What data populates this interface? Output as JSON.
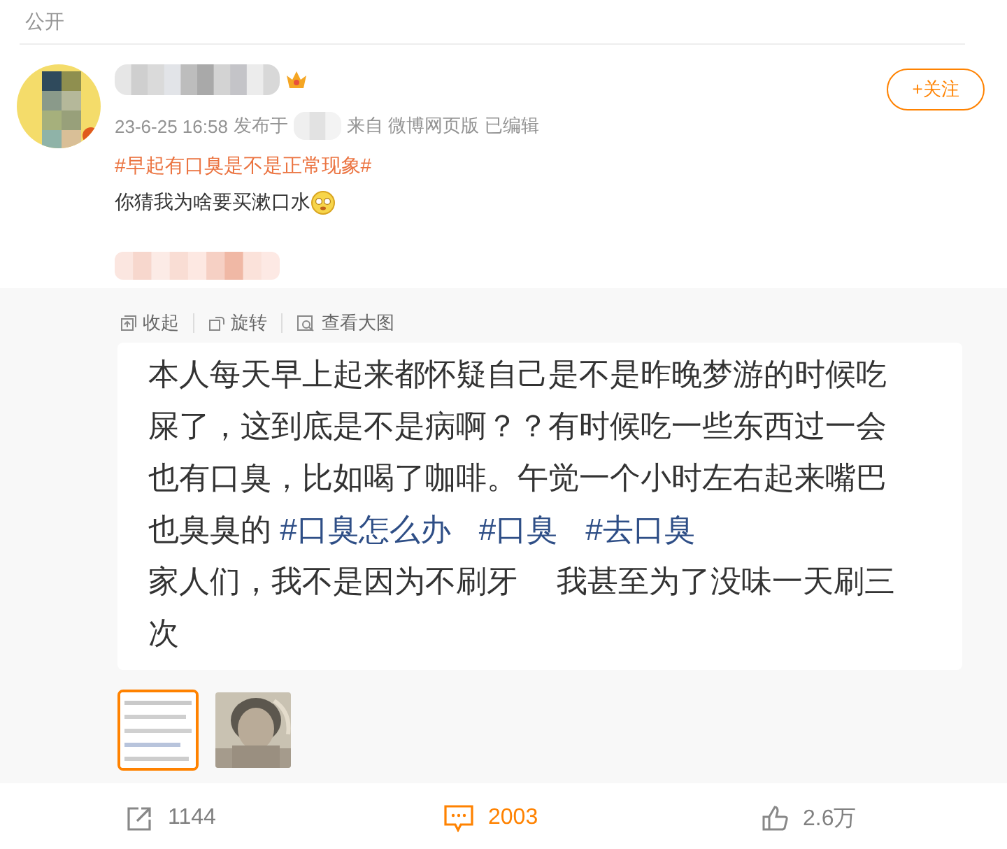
{
  "visibility": "公开",
  "post": {
    "timestamp": "23-6-25 16:58",
    "posted_at_label": "发布于",
    "source": "来自 微博网页版",
    "edited": "已编辑",
    "follow_button": "+关注",
    "topic": "#早起有口臭是不是正常现象#",
    "text": "你猜我为啥要买漱口水"
  },
  "media_toolbar": [
    {
      "kind": "collapse",
      "label": "收起"
    },
    {
      "kind": "rotate",
      "label": "旋转"
    },
    {
      "kind": "enlarge",
      "label": "查看大图"
    }
  ],
  "image_paragraphs": [
    {
      "segments": [
        {
          "kind": "text",
          "text": "本人每天早上起来都怀疑自己是不是昨晚梦游的时候吃屎了，这到底是不是病啊？？有时候吃一些东西过一会也有口臭，比如喝了咖啡。午觉一个小时左右起来嘴巴也臭臭的 "
        },
        {
          "kind": "hashtag",
          "text": "#口臭怎么办"
        },
        {
          "kind": "hashtag",
          "text": "#口臭"
        },
        {
          "kind": "hashtag",
          "text": "#去口臭"
        }
      ]
    },
    {
      "segments": [
        {
          "kind": "text",
          "text": "家人们，我不是因为不刷牙　 我甚至为了没味一天刷三次"
        }
      ]
    }
  ],
  "thumbnails": [
    {
      "kind": "picture",
      "selected": true
    },
    {
      "kind": "picture",
      "selected": false
    }
  ],
  "actions": [
    {
      "kind": "share",
      "count": "1144",
      "selected": false
    },
    {
      "kind": "comment",
      "count": "2003",
      "selected": true
    },
    {
      "kind": "like",
      "count": "2.6万",
      "selected": false
    }
  ]
}
